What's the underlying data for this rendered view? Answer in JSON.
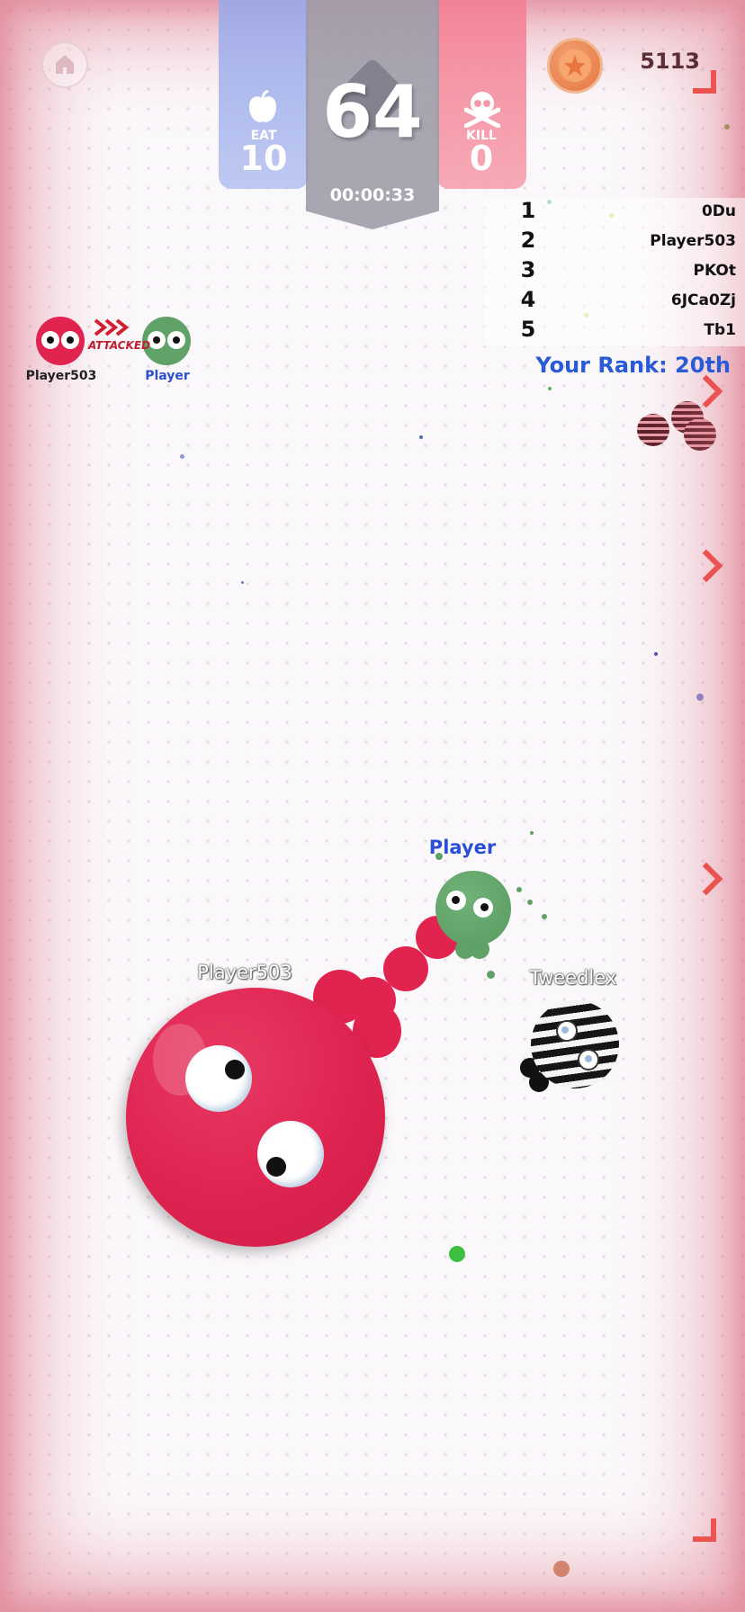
{
  "hud": {
    "eat_label": "EAT",
    "eat_value": "10",
    "size_value": "64",
    "timer": "00:00:33",
    "kill_label": "KILL",
    "kill_value": "0",
    "coins": "5113"
  },
  "leaderboard": {
    "rows": [
      {
        "rank": "1",
        "name": "0Du"
      },
      {
        "rank": "2",
        "name": "Player503"
      },
      {
        "rank": "3",
        "name": "PKOt"
      },
      {
        "rank": "4",
        "name": "6JCa0Zj"
      },
      {
        "rank": "5",
        "name": "Tb1"
      }
    ],
    "your_rank": "Your Rank: 20th"
  },
  "attack_notice": {
    "attacker": "Player503",
    "victim": "Player",
    "label": "ATTACKED"
  },
  "arena": {
    "player_name": "Player",
    "enemy_name": "Player503",
    "other_name": "Tweedlex"
  },
  "colors": {
    "enemy": "#e0234f",
    "player": "#5fa167",
    "rank_text": "#2a5bd6",
    "border": "#e6788a"
  },
  "icons": [
    "home-icon",
    "apple-icon",
    "skull-icon",
    "coin-icon"
  ]
}
